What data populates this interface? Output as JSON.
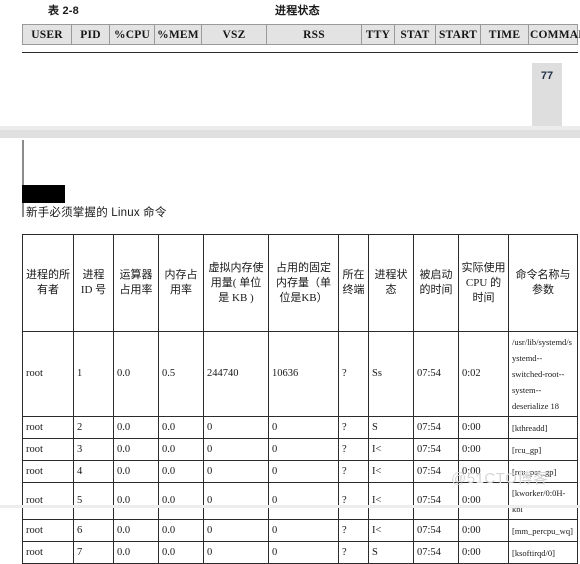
{
  "document": {
    "caption_label": "表 2-8",
    "caption_title": "进程状态",
    "page_number": "77",
    "section_heading": "新手必须掌握的 Linux 命令",
    "watermark": "@51CTO博客"
  },
  "ps_header": {
    "columns": [
      "USER",
      "PID",
      "%CPU",
      "%MEM",
      "VSZ",
      "RSS",
      "TTY",
      "STAT",
      "START",
      "TIME",
      "COMMAND"
    ]
  },
  "process_table": {
    "headers": [
      "进程的所有者",
      "进程 ID 号",
      "运算器占用率",
      "内存占用率",
      "虚拟内存使用量( 单位是 KB )",
      "占用的固定内存量（单位是KB）",
      "所在终端",
      "进程状态",
      "被启动的时间",
      "实际使用 CPU 的时间",
      "命令名称与参数"
    ],
    "rows": [
      {
        "user": "root",
        "pid": "1",
        "cpu": "0.0",
        "mem": "0.5",
        "vsz": "244740",
        "rss": "10636",
        "tty": "?",
        "stat": "Ss",
        "start": "07:54",
        "time": "0:02",
        "command": "/usr/lib/systemd/systemd--switched-root--system--deserialize 18",
        "tall": true
      },
      {
        "user": "root",
        "pid": "2",
        "cpu": "0.0",
        "mem": "0.0",
        "vsz": "0",
        "rss": "0",
        "tty": "?",
        "stat": "S",
        "start": "07:54",
        "time": "0:00",
        "command": "[kthreadd]",
        "tall": false
      },
      {
        "user": "root",
        "pid": "3",
        "cpu": "0.0",
        "mem": "0.0",
        "vsz": "0",
        "rss": "0",
        "tty": "?",
        "stat": "I<",
        "start": "07:54",
        "time": "0:00",
        "command": "[rcu_gp]",
        "tall": false
      },
      {
        "user": "root",
        "pid": "4",
        "cpu": "0.0",
        "mem": "0.0",
        "vsz": "0",
        "rss": "0",
        "tty": "?",
        "stat": "I<",
        "start": "07:54",
        "time": "0:00",
        "command": "[rcu_par_gp]",
        "tall": false
      },
      {
        "user": "root",
        "pid": "5",
        "cpu": "0.0",
        "mem": "0.0",
        "vsz": "0",
        "rss": "0",
        "tty": "?",
        "stat": "I<",
        "start": "07:54",
        "time": "0:00",
        "command": "[kworker/0:0H-kbl",
        "tall": false
      },
      {
        "user": "root",
        "pid": "6",
        "cpu": "0.0",
        "mem": "0.0",
        "vsz": "0",
        "rss": "0",
        "tty": "?",
        "stat": "I<",
        "start": "07:54",
        "time": "0:00",
        "command": "[mm_percpu_wq]",
        "tall": false
      },
      {
        "user": "root",
        "pid": "7",
        "cpu": "0.0",
        "mem": "0.0",
        "vsz": "0",
        "rss": "0",
        "tty": "?",
        "stat": "S",
        "start": "07:54",
        "time": "0:00",
        "command": "[ksoftirqd/0]",
        "tall": false
      }
    ]
  }
}
